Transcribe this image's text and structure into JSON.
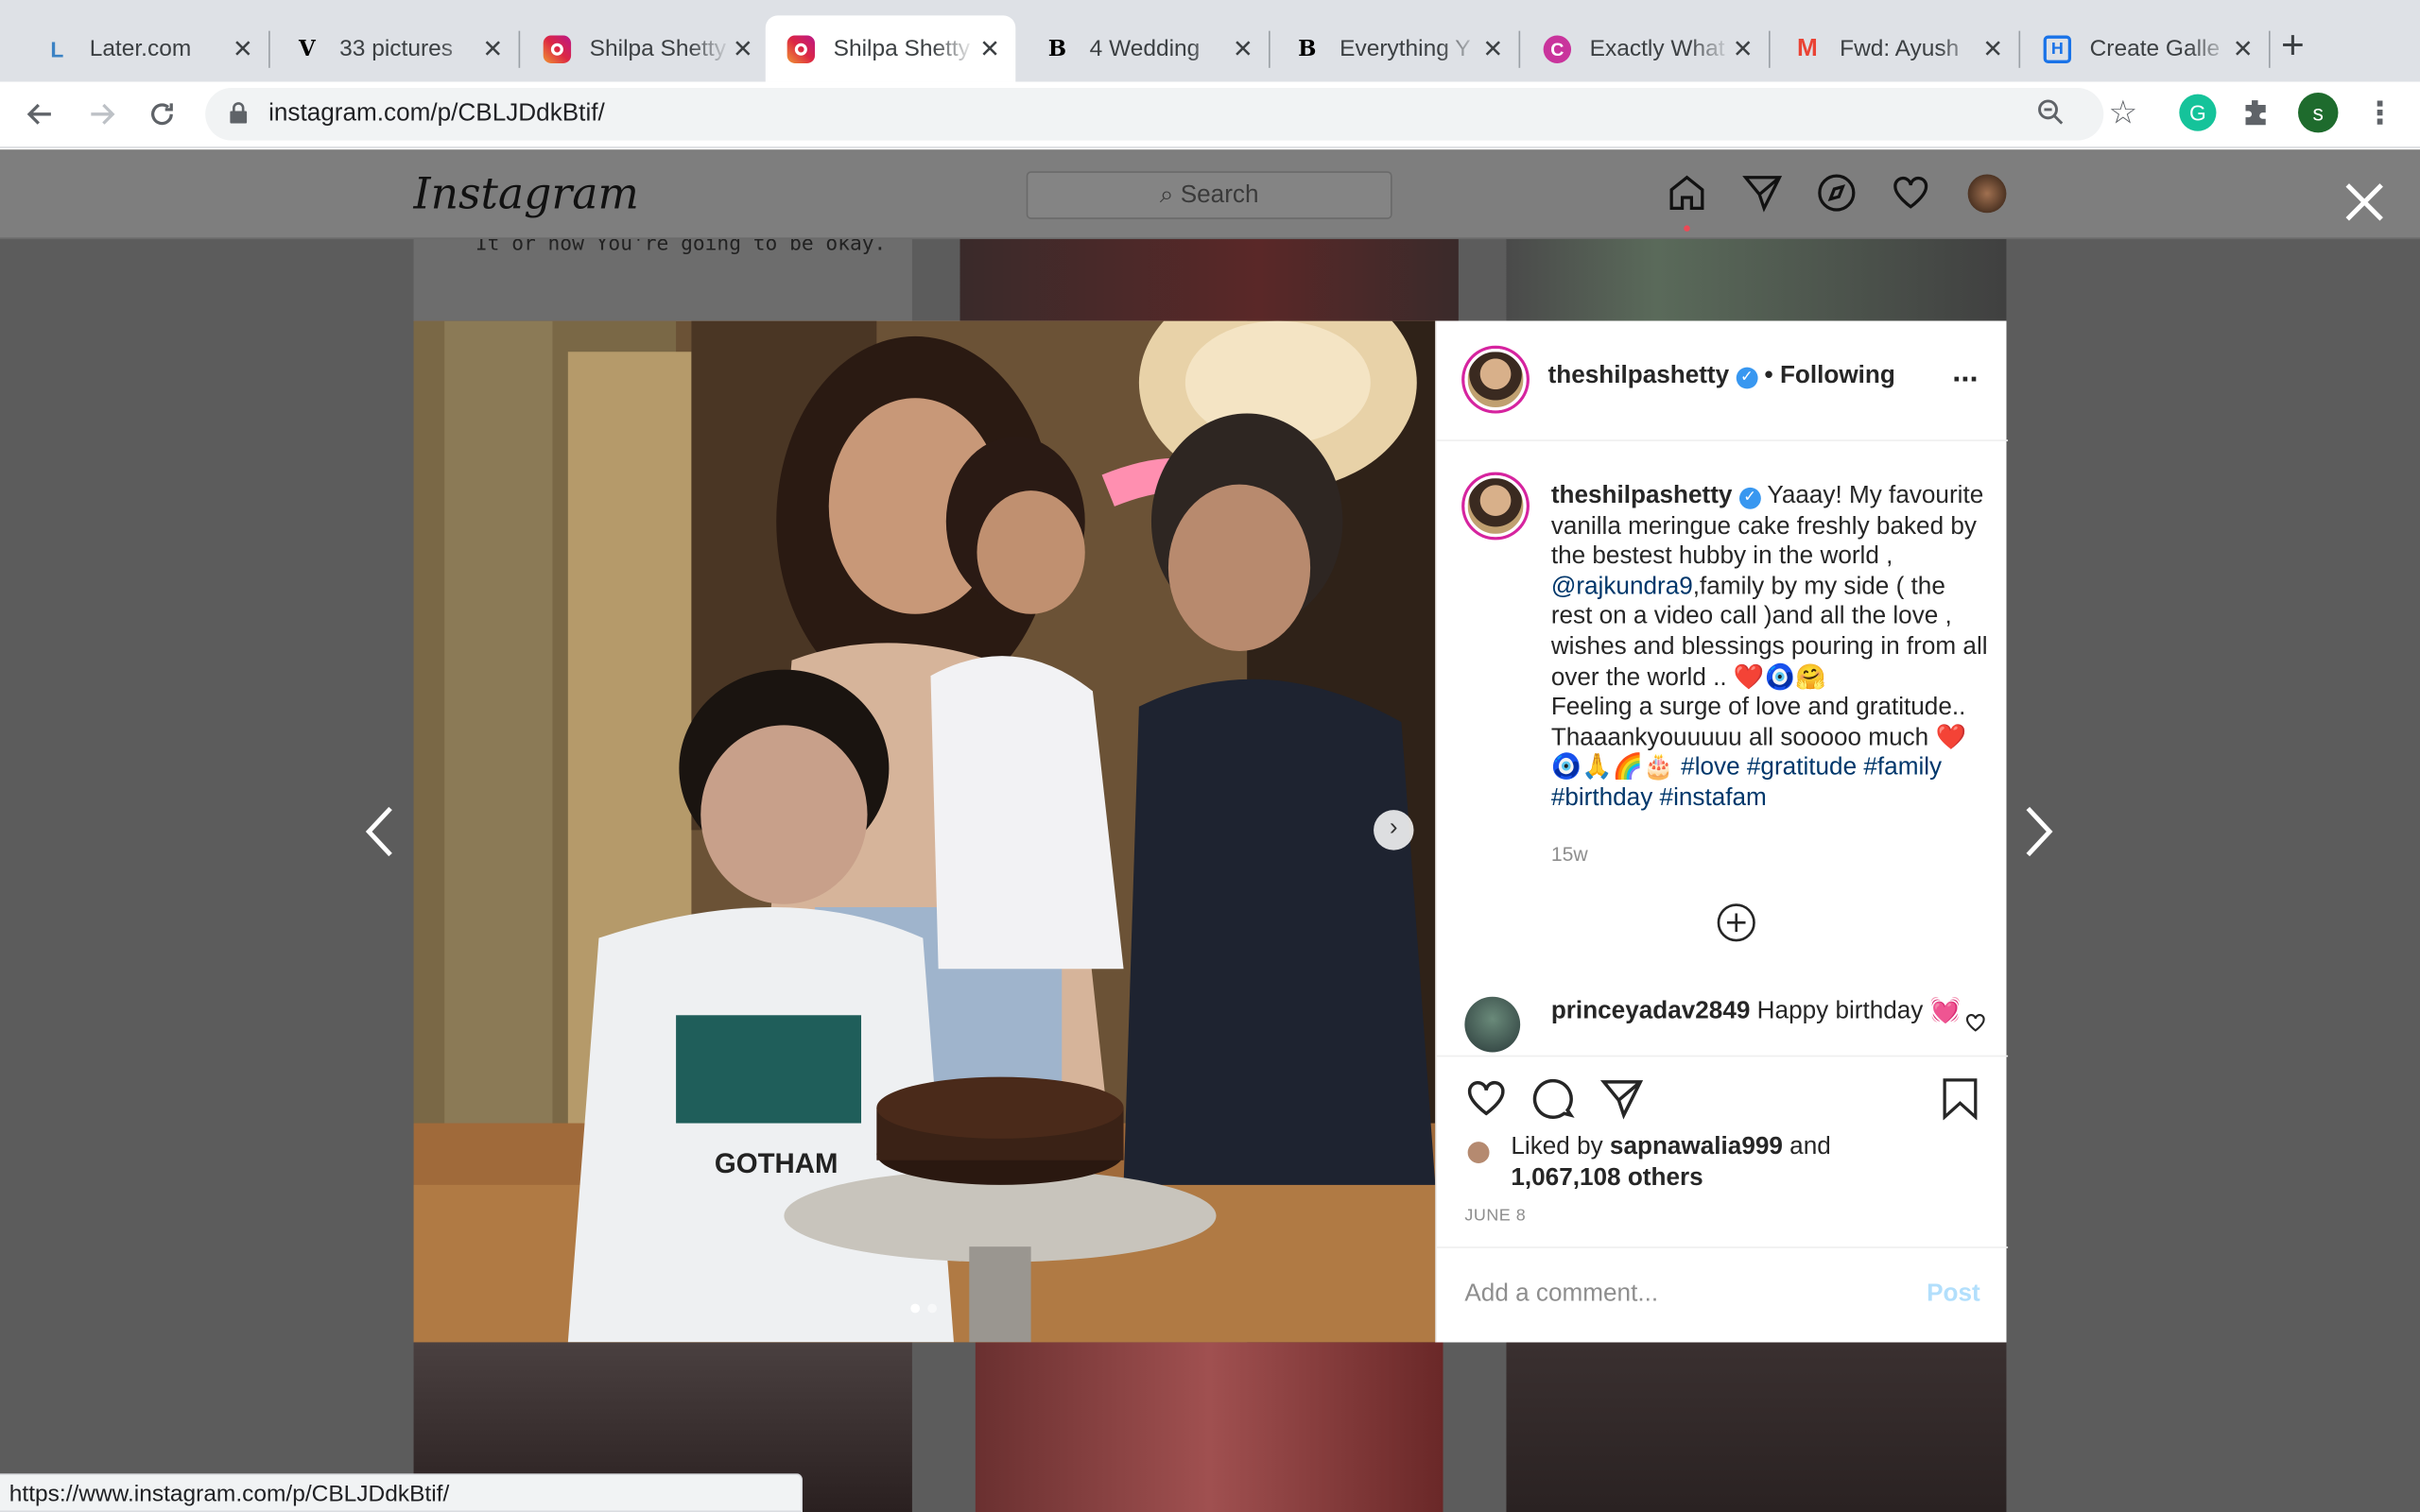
{
  "browser": {
    "tabs": [
      {
        "title": "Later.com",
        "favicon": "later-icon",
        "active": false
      },
      {
        "title": "33 pictures",
        "favicon": "vogue-icon",
        "active": false
      },
      {
        "title": "Shilpa Shetty",
        "favicon": "instagram-icon",
        "active": false
      },
      {
        "title": "Shilpa Shetty",
        "favicon": "instagram-icon",
        "active": true
      },
      {
        "title": "4 Wedding",
        "favicon": "bazaar-icon",
        "active": false
      },
      {
        "title": "Everything Y",
        "favicon": "bazaar-icon",
        "active": false
      },
      {
        "title": "Exactly What",
        "favicon": "c-icon",
        "active": false
      },
      {
        "title": "Fwd: Ayush",
        "favicon": "gmail-icon",
        "active": false
      },
      {
        "title": "Create Galle",
        "favicon": "h-icon",
        "active": false
      }
    ],
    "url": "instagram.com/p/CBLJDdkBtif/",
    "profile_initial": "s",
    "status_url": "https://www.instagram.com/p/CBLJDdkBtif/"
  },
  "instagram": {
    "logo": "Instagram",
    "search_placeholder": "Search",
    "bg_text": "It or how You're going to be okay."
  },
  "post": {
    "author": "theshilpashetty",
    "following": "• Following",
    "more": "...",
    "caption_parts": [
      "Yaaay! My favourite vanilla meringue cake freshly baked by the bestest hubby in the world ,"
    ],
    "mention": "@rajkundra9",
    "caption_cont": ",family by my side ( the rest on a video call )and all the love , wishes and blessings pouring in from all over the world .. ❤️🧿🤗",
    "caption_line2": "Feeling a surge of love and gratitude.. Thaaankyouuuuu all sooooo much ❤️🧿🙏🌈🎂",
    "hashtags": [
      "#love",
      "#gratitude",
      "#family",
      "#birthday",
      "#instafam"
    ],
    "age": "15w",
    "comment_user": "princeyadav2849",
    "comment_text": "Happy birthday 💓",
    "liked_prefix": "Liked by",
    "liked_user": "sapnawalia999",
    "liked_and": "and",
    "liked_others": "1,067,108 others",
    "date": "JUNE 8",
    "comment_placeholder": "Add a comment...",
    "post_label": "Post",
    "photo_text": "GOTHAM"
  },
  "colors": {
    "accent": "#0095f6",
    "verified": "#3897f0",
    "overlay": "#5c5c5c"
  }
}
